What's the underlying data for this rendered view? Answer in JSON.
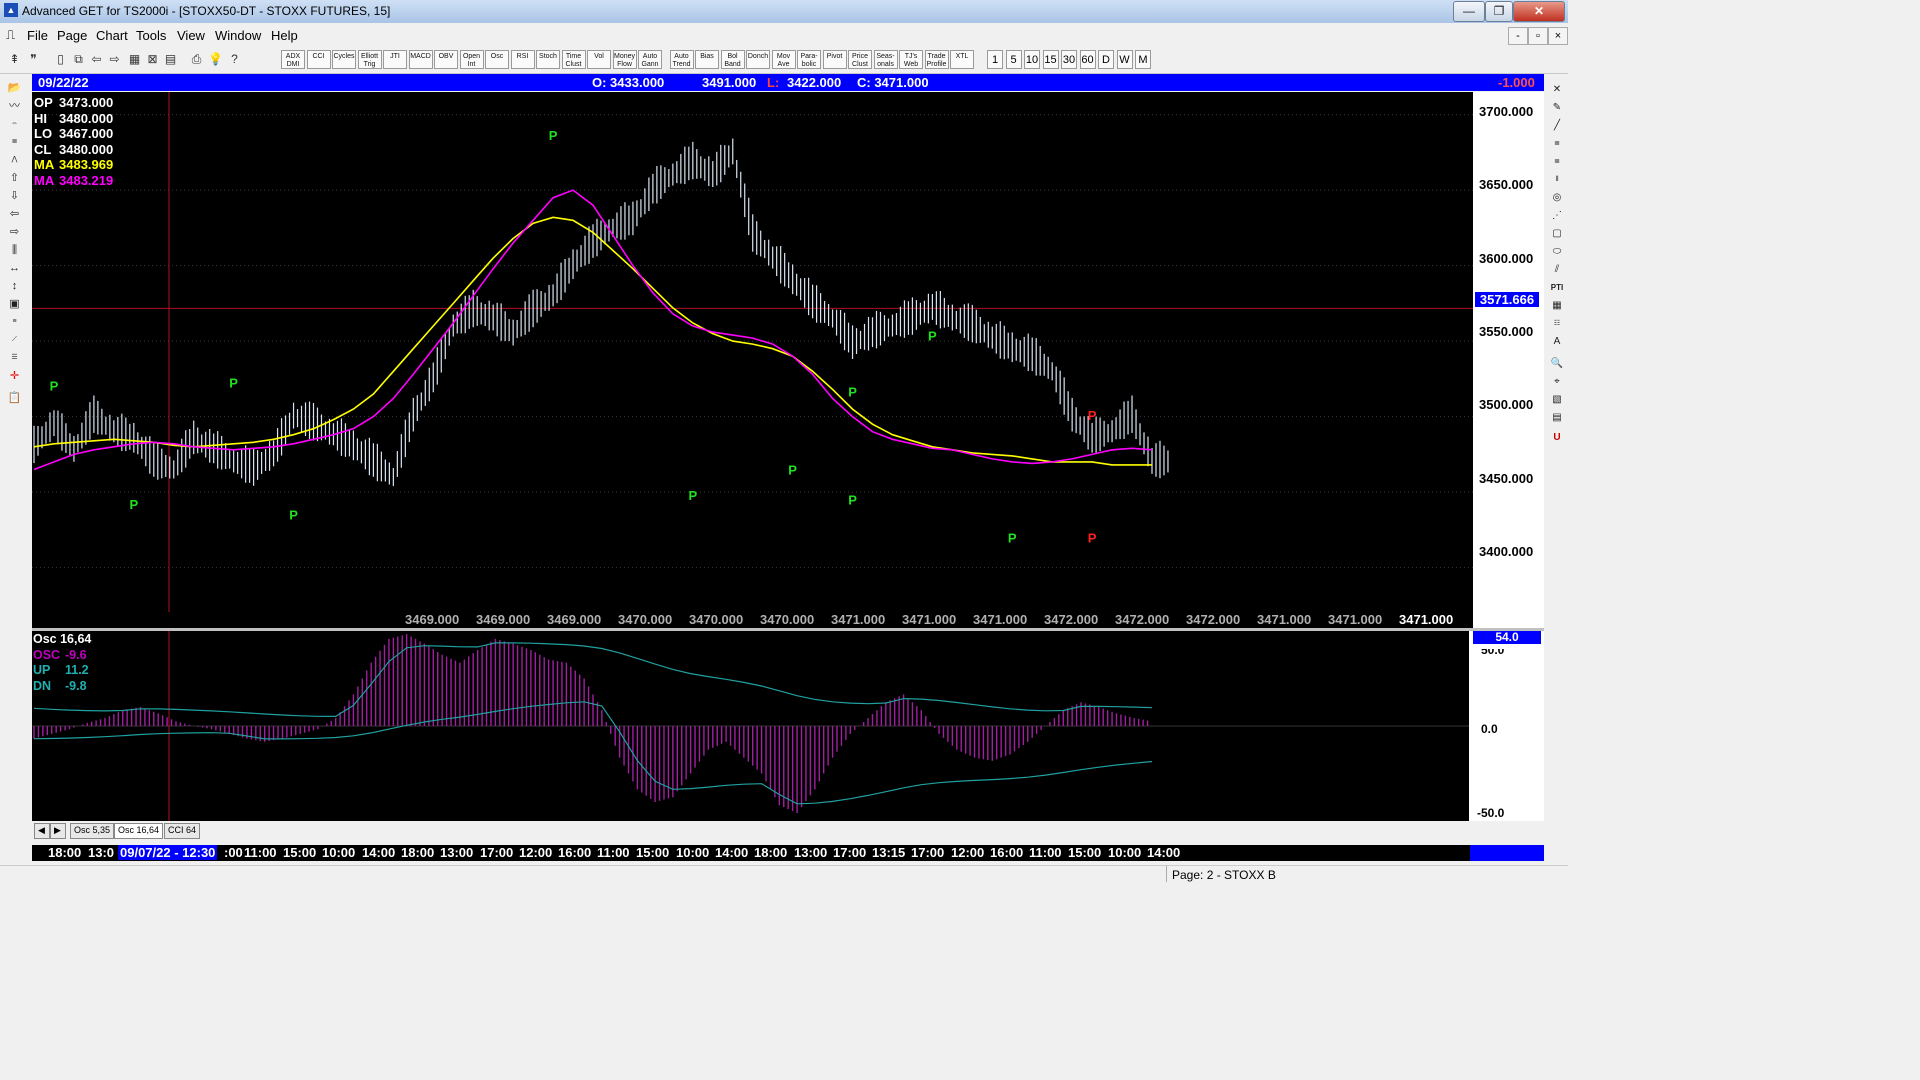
{
  "window": {
    "title": "Advanced GET for TS2000i - [STOXX50-DT - STOXX FUTURES, 15]",
    "min_label": "—",
    "max_label": "❐",
    "close_label": "✕"
  },
  "menu": {
    "items": [
      "File",
      "Page",
      "Chart",
      "Tools",
      "View",
      "Window",
      "Help"
    ],
    "mdi": [
      "-",
      "▫",
      "×"
    ]
  },
  "toolbar": {
    "study_buttons": [
      "ADX DMI",
      "CCI",
      "Cycles",
      "Elliott Trig",
      "JTI",
      "MACD",
      "OBV",
      "Open Int",
      "Osc",
      "RSI",
      "Stoch",
      "Time Clust",
      "Vol",
      "Money Flow",
      "Auto Gann",
      "Auto Trend",
      "Bias",
      "Bol Band",
      "Donch",
      "Mov Ave",
      "Para- bolic",
      "Pivot",
      "Price Clust",
      "Seas- onals",
      "TJ's Web",
      "Trade Profile",
      "XTL"
    ],
    "periods": [
      "1",
      "5",
      "10",
      "15",
      "30",
      "60",
      "D",
      "W",
      "M"
    ]
  },
  "header": {
    "date": "09/22/22",
    "open": "O: 3433.000",
    "high": "3491.000",
    "low_label": "L:",
    "low": "3422.000",
    "close": "C: 3471.000",
    "change": "-1.000"
  },
  "ohlc_info": [
    {
      "label": "OP",
      "value": "3473.000",
      "color": "#ffffff"
    },
    {
      "label": "HI",
      "value": "3480.000",
      "color": "#ffffff"
    },
    {
      "label": "LO",
      "value": "3467.000",
      "color": "#ffffff"
    },
    {
      "label": "CL",
      "value": "3480.000",
      "color": "#ffffff"
    },
    {
      "label": "MA",
      "value": "3483.969",
      "color": "#ffff00"
    },
    {
      "label": "MA",
      "value": "3483.219",
      "color": "#ff00ff"
    }
  ],
  "price_axis": {
    "ticks": [
      "3700.000",
      "3650.000",
      "3600.000",
      "3550.000",
      "3500.000",
      "3450.000",
      "3400.000"
    ],
    "marker": "3571.666"
  },
  "bottom_values": [
    "3469.000",
    "3469.000",
    "3469.000",
    "3470.000",
    "3470.000",
    "3470.000",
    "3471.000",
    "3471.000",
    "3471.000",
    "3472.000",
    "3472.000",
    "3472.000",
    "3471.000",
    "3471.000",
    "3471.000"
  ],
  "pivot_label": "P",
  "osc_info": [
    {
      "label": "Osc 16,64",
      "value": "",
      "color": "#ffffff"
    },
    {
      "label": "OSC",
      "value": "-9.6",
      "color": "#c000c0"
    },
    {
      "label": "UP",
      "value": "11.2",
      "color": "#20b0b0"
    },
    {
      "label": "DN",
      "value": "-9.8",
      "color": "#20b0b0"
    }
  ],
  "osc_axis": {
    "marker": "54.0",
    "ticks": [
      "50.0",
      "0.0",
      "-50.0"
    ]
  },
  "tabs": [
    "Osc 5,35",
    "Osc 16,64",
    "CCI 64"
  ],
  "time_axis": {
    "labels": [
      "18:00",
      "13:0",
      "09/07/22 - 12:30",
      ":00",
      "11:00",
      "15:00",
      "10:00",
      "14:00",
      "18:00",
      "13:00",
      "17:00",
      "12:00",
      "16:00",
      "11:00",
      "15:00",
      "10:00",
      "14:00",
      "18:00",
      "13:00",
      "17:00",
      "13:15",
      "17:00",
      "12:00",
      "16:00",
      "11:00",
      "15:00",
      "10:00",
      "14:00"
    ]
  },
  "status": {
    "page": "Page: 2 - STOXX B"
  },
  "chart_data": {
    "type": "line",
    "title": "",
    "xlabel": "",
    "ylabel": "",
    "ylim": [
      3360,
      3715
    ],
    "x": [
      0,
      1,
      2,
      3,
      4,
      5,
      6,
      7,
      8,
      9,
      10,
      11,
      12,
      13,
      14,
      15,
      16,
      17,
      18,
      19,
      20,
      21,
      22,
      23,
      24,
      25,
      26,
      27,
      28,
      29,
      30,
      31,
      32,
      33,
      34,
      35,
      36,
      37,
      38,
      39,
      40,
      41,
      42,
      43,
      44,
      45,
      46,
      47,
      48,
      49,
      50,
      51,
      52,
      53,
      54,
      55,
      56
    ],
    "series": [
      {
        "values": [
          3480,
          3495,
          3478,
          3500,
          3490,
          3485,
          3470,
          3465,
          3485,
          3478,
          3470,
          3465,
          3475,
          3500,
          3495,
          3488,
          3480,
          3470,
          3460,
          3500,
          3525,
          3560,
          3570,
          3565,
          3555,
          3570,
          3580,
          3600,
          3615,
          3625,
          3630,
          3650,
          3660,
          3668,
          3660,
          3675,
          3620,
          3605,
          3590,
          3575,
          3565,
          3548,
          3555,
          3560,
          3565,
          3572,
          3565,
          3560,
          3552,
          3545,
          3540,
          3530,
          3500,
          3485,
          3490,
          3500,
          3470
        ]
      },
      {
        "values": [
          3480,
          3482,
          3483,
          3484,
          3485,
          3484,
          3483,
          3481,
          3480,
          3481,
          3482,
          3483,
          3485,
          3488,
          3492,
          3498,
          3505,
          3515,
          3530,
          3545,
          3560,
          3575,
          3590,
          3605,
          3618,
          3628,
          3632,
          3630,
          3622,
          3610,
          3598,
          3585,
          3572,
          3562,
          3555,
          3550,
          3548,
          3545,
          3540,
          3530,
          3518,
          3505,
          3495,
          3488,
          3484,
          3480,
          3478,
          3476,
          3475,
          3474,
          3472,
          3470,
          3470,
          3470,
          3468,
          3468,
          3468
        ]
      },
      {
        "values": [
          3465,
          3470,
          3475,
          3478,
          3480,
          3482,
          3483,
          3482,
          3480,
          3479,
          3478,
          3479,
          3480,
          3482,
          3485,
          3488,
          3492,
          3500,
          3512,
          3528,
          3545,
          3562,
          3580,
          3598,
          3615,
          3630,
          3645,
          3650,
          3640,
          3620,
          3600,
          3582,
          3568,
          3560,
          3556,
          3554,
          3552,
          3548,
          3540,
          3528,
          3512,
          3500,
          3490,
          3485,
          3482,
          3479,
          3478,
          3475,
          3472,
          3470,
          3469,
          3470,
          3472,
          3475,
          3478,
          3479,
          3478
        ]
      }
    ],
    "pivots_low_green": [
      3452,
      3445,
      3458,
      3475,
      3455,
      3430
    ],
    "pivots_high_green": [
      3512,
      3514,
      3678,
      3508,
      3545
    ],
    "pivots_high_red": [
      3495
    ],
    "pivots_low_red": [
      3430
    ],
    "hline": 3571.666,
    "osc": {
      "ylim": [
        -60,
        60
      ],
      "values": [
        -8,
        -5,
        -2,
        2,
        5,
        10,
        12,
        8,
        3,
        0,
        -2,
        -5,
        -8,
        -10,
        -8,
        -5,
        -2,
        5,
        20,
        40,
        55,
        58,
        52,
        45,
        40,
        48,
        55,
        52,
        48,
        42,
        40,
        30,
        10,
        -20,
        -40,
        -48,
        -45,
        -30,
        -15,
        -10,
        -20,
        -30,
        -50,
        -55,
        -40,
        -20,
        -5,
        5,
        15,
        20,
        10,
        -5,
        -15,
        -20,
        -22,
        -18,
        -10,
        0,
        10,
        15,
        12,
        8,
        5,
        3
      ]
    }
  }
}
